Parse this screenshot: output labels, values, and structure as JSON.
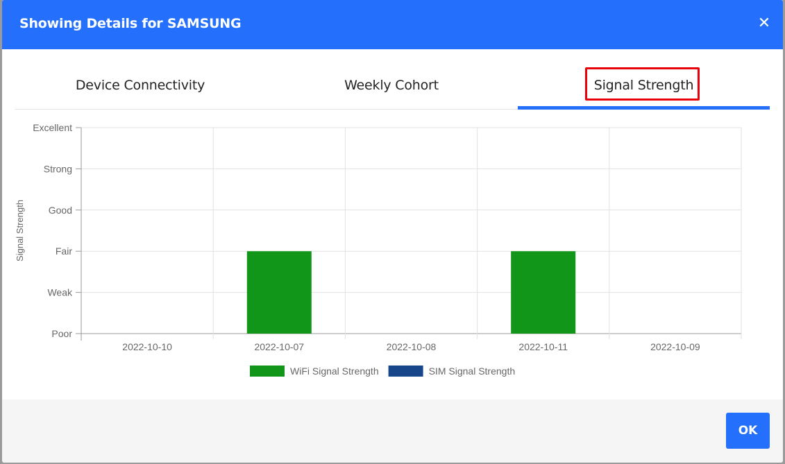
{
  "modal": {
    "title": "Showing Details for SAMSUNG",
    "close_glyph": "✕",
    "ok_label": "OK"
  },
  "tabs": [
    {
      "label": "Device Connectivity",
      "active": false
    },
    {
      "label": "Weekly Cohort",
      "active": false
    },
    {
      "label": "Signal Strength",
      "active": true
    }
  ],
  "colors": {
    "header": "#2470fd",
    "accent": "#2470fd",
    "highlight": "#e8000b",
    "wifi": "#129619",
    "sim": "#17478a"
  },
  "chart_data": {
    "type": "bar",
    "ylabel": "Signal Strength",
    "xlabel": "",
    "y_levels": [
      "Poor",
      "Weak",
      "Fair",
      "Good",
      "Strong",
      "Excellent"
    ],
    "ylim": [
      0,
      5
    ],
    "categories": [
      "2022-10-10",
      "2022-10-07",
      "2022-10-08",
      "2022-10-11",
      "2022-10-09"
    ],
    "series": [
      {
        "name": "WiFi Signal Strength",
        "values": [
          0,
          2,
          0,
          2,
          0
        ]
      },
      {
        "name": "SIM Signal Strength",
        "values": [
          0,
          0,
          0,
          0,
          0
        ]
      }
    ],
    "grid": true,
    "legend": "bottom"
  }
}
